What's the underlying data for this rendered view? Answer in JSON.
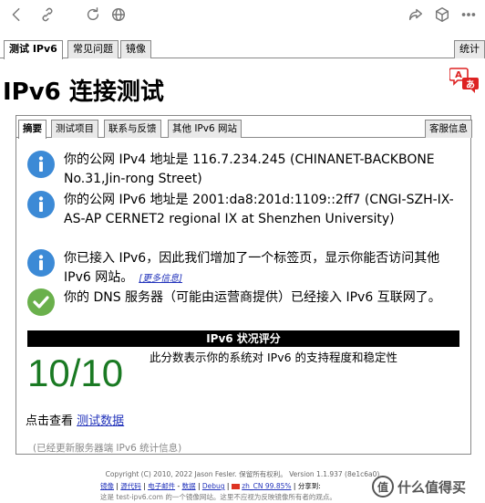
{
  "browser": {
    "icons": [
      "back-icon",
      "link-icon",
      "reload-icon",
      "globe-icon",
      "share-icon",
      "cube-icon",
      "more-icon"
    ]
  },
  "top_tabs": {
    "test": "测试 IPv6",
    "faq": "常见问题",
    "mirror": "镜像",
    "stats": "统计"
  },
  "page_title": "IPv6 连接测试",
  "panel_tabs": {
    "summary": "摘要",
    "tests": "测试项目",
    "contact": "联系与反馈",
    "other_sites": "其他 IPv6 网站",
    "client_info": "客服信息"
  },
  "messages": [
    {
      "icon": "info-icon",
      "text": "你的公网 IPv4 地址是 116.7.234.245 (CHINANET-BACKBONE No.31,Jin-rong Street)"
    },
    {
      "icon": "info-icon",
      "text": "你的公网 IPv6 地址是 2001:da8:201d:1109::2ff7 (CNGI-SZH-IX-AS-AP CERNET2 regional IX at Shenzhen University)"
    },
    {
      "icon": "info-icon",
      "text": "你已接入 IPv6，因此我们增加了一个标签页，显示你能否访问其他 IPv6 网站。",
      "link": "[更多信息]"
    },
    {
      "icon": "check-icon",
      "text": "你的 DNS 服务器（可能由运营商提供）已经接入 IPv6 互联网了。"
    }
  ],
  "score": {
    "header": "IPv6 状况评分",
    "value": "10/10",
    "description": "此分数表示你的系统对 IPv6 的支持程度和稳定性"
  },
  "detail": {
    "prefix": "点击查看",
    "link": "测试数据"
  },
  "footnote": "(已经更新服务器端 IPv6 统计信息)",
  "footer": {
    "copyright": "Copyright (C) 2010, 2022 Jason Fesler. 保留所有权利。 Version 1.1.937 (8e1c6a0)",
    "links": [
      "镜像",
      "源代码",
      "电子邮件",
      "数据",
      "Debug",
      "zh_CN 99.85%",
      "分享到:"
    ],
    "mirror_note": "这是 test-ipv6.com 的一个镜像网站。这里不应视为反映镜像所有者的观点。"
  },
  "watermark": "什么值得买"
}
